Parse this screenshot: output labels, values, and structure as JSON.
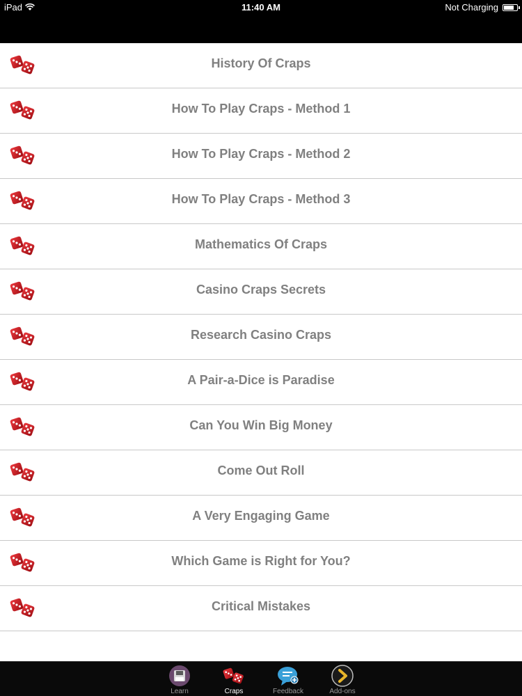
{
  "status_bar": {
    "device": "iPad",
    "time": "11:40 AM",
    "battery_status": "Not Charging"
  },
  "list": {
    "icon": "dice-icon",
    "items": [
      "History Of Craps",
      "How To Play Craps - Method 1",
      "How To Play Craps - Method 2",
      "How To Play Craps - Method 3",
      "Mathematics Of Craps",
      "Casino Craps Secrets",
      "Research Casino Craps",
      "A Pair-a-Dice is Paradise",
      "Can You Win Big Money",
      "Come Out Roll",
      "A Very Engaging Game",
      "Which Game is Right for You?",
      "Critical Mistakes"
    ]
  },
  "tab_bar": {
    "active": "Craps",
    "tabs": [
      {
        "label": "Learn",
        "icon": "save-disk-icon"
      },
      {
        "label": "Craps",
        "icon": "dice-icon"
      },
      {
        "label": "Feedback",
        "icon": "chat-bubble-icon"
      },
      {
        "label": "Add-ons",
        "icon": "chevron-right-icon"
      }
    ]
  },
  "colors": {
    "bar_background": "#000000",
    "list_text": "#808080",
    "divider": "#c8c8c8",
    "dice_red": "#c0141c"
  }
}
